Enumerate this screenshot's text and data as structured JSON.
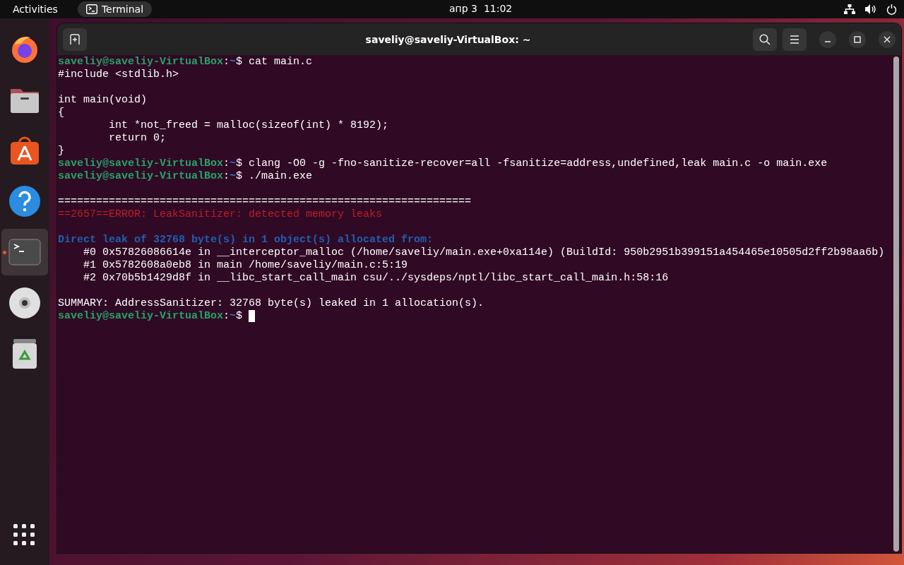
{
  "top_bar": {
    "activities": "Activities",
    "app_menu": {
      "label": "Terminal"
    },
    "clock": "апр 3  11:02"
  },
  "dock": {
    "items": [
      {
        "kind": "browser",
        "selected": false,
        "running": false
      },
      {
        "kind": "files",
        "selected": false,
        "running": false
      },
      {
        "kind": "software",
        "selected": false,
        "running": false
      },
      {
        "kind": "help",
        "selected": false,
        "running": false
      },
      {
        "kind": "terminal",
        "selected": true,
        "running": true
      },
      {
        "kind": "disc",
        "selected": false,
        "running": false
      },
      {
        "kind": "trash",
        "selected": false,
        "running": false
      }
    ]
  },
  "window": {
    "title": "saveliy@saveliy-VirtualBox: ~"
  },
  "terminal": {
    "blocks": [
      {
        "lines": [
          {
            "segments": [
              {
                "kind": "user",
                "text": "saveliy@saveliy-VirtualBox"
              },
              {
                "kind": "plain",
                "text": ":"
              },
              {
                "kind": "path",
                "text": "~"
              },
              {
                "kind": "plain",
                "text": "$ cat main.c"
              }
            ]
          },
          {
            "segments": [
              {
                "kind": "plain",
                "text": "#include <stdlib.h>"
              }
            ]
          }
        ]
      },
      {
        "lines": [
          {
            "segments": [
              {
                "kind": "plain",
                "text": "int main(void)"
              }
            ]
          },
          {
            "segments": [
              {
                "kind": "plain",
                "text": "{"
              }
            ]
          },
          {
            "segments": [
              {
                "kind": "plain",
                "text": "        int *not_freed = malloc(sizeof(int) * 8192);"
              }
            ]
          },
          {
            "segments": [
              {
                "kind": "plain",
                "text": "        return 0;"
              }
            ]
          },
          {
            "segments": [
              {
                "kind": "plain",
                "text": "}"
              }
            ]
          },
          {
            "segments": [
              {
                "kind": "user",
                "text": "saveliy@saveliy-VirtualBox"
              },
              {
                "kind": "plain",
                "text": ":"
              },
              {
                "kind": "path",
                "text": "~"
              },
              {
                "kind": "plain",
                "text": "$ clang -O0 -g -fno-sanitize-recover=all -fsanitize=address,undefined,leak main.c -o main.exe"
              }
            ]
          },
          {
            "segments": [
              {
                "kind": "user",
                "text": "saveliy@saveliy-VirtualBox"
              },
              {
                "kind": "plain",
                "text": ":"
              },
              {
                "kind": "path",
                "text": "~"
              },
              {
                "kind": "plain",
                "text": "$ ./main.exe"
              }
            ]
          }
        ]
      },
      {
        "lines": [
          {
            "segments": [
              {
                "kind": "plain",
                "text": "================================================================="
              }
            ]
          },
          {
            "segments": [
              {
                "kind": "error",
                "text": "==2657==ERROR: LeakSanitizer: detected memory leaks"
              }
            ]
          }
        ]
      },
      {
        "lines": [
          {
            "segments": [
              {
                "kind": "info",
                "text": "Direct leak of 32768 byte(s) in 1 object(s) allocated from:"
              }
            ]
          },
          {
            "segments": [
              {
                "kind": "plain",
                "text": "    #0 0x57826086614e in __interceptor_malloc (/home/saveliy/main.exe+0xa114e) (BuildId: 950b2951b399151a454465e10505d2ff2b98aa6b)"
              }
            ]
          },
          {
            "segments": [
              {
                "kind": "plain",
                "text": "    #1 0x5782608a0eb8 in main /home/saveliy/main.c:5:19"
              }
            ]
          },
          {
            "segments": [
              {
                "kind": "plain",
                "text": "    #2 0x70b5b1429d8f in __libc_start_call_main csu/../sysdeps/nptl/libc_start_call_main.h:58:16"
              }
            ]
          }
        ]
      },
      {
        "lines": [
          {
            "segments": [
              {
                "kind": "plain",
                "text": "SUMMARY: AddressSanitizer: 32768 byte(s) leaked in 1 allocation(s)."
              }
            ]
          },
          {
            "segments": [
              {
                "kind": "user",
                "text": "saveliy@saveliy-VirtualBox"
              },
              {
                "kind": "plain",
                "text": ":"
              },
              {
                "kind": "path",
                "text": "~"
              },
              {
                "kind": "plain",
                "text": "$ "
              }
            ],
            "cursor": true
          }
        ]
      }
    ]
  }
}
